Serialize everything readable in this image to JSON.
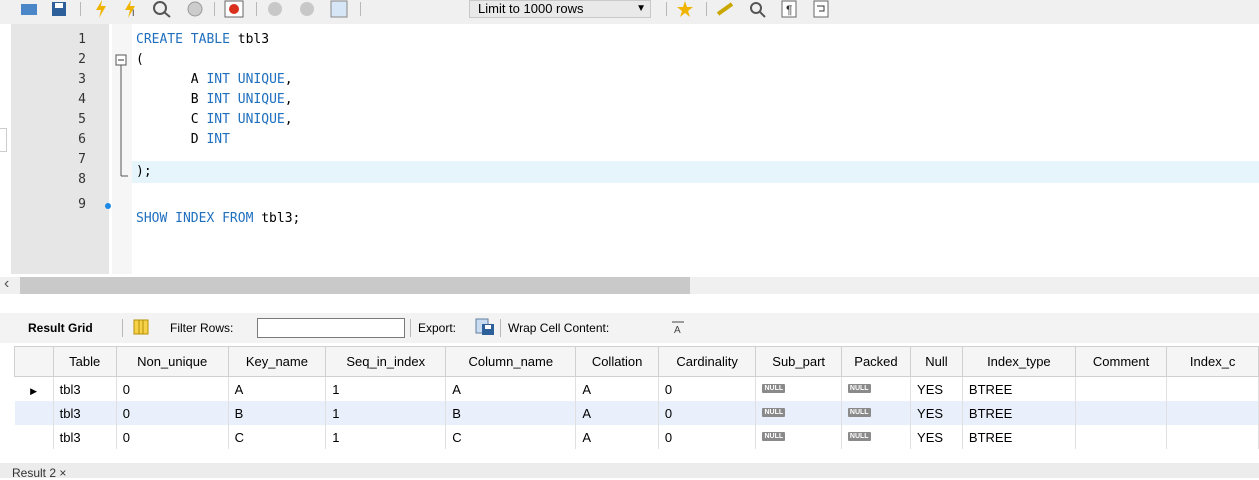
{
  "toolbar": {
    "limit_label": "Limit to 1000 rows"
  },
  "editor": {
    "line_numbers": [
      "1",
      "2",
      "3",
      "4",
      "5",
      "6",
      "7",
      "8",
      "9"
    ],
    "lines": [
      {
        "id": "l1",
        "parts": [
          {
            "t": "CREATE TABLE ",
            "k": true
          },
          {
            "t": "tbl3",
            "k": false
          }
        ]
      },
      {
        "id": "l2",
        "parts": [
          {
            "t": "(",
            "k": false
          }
        ]
      },
      {
        "id": "l3",
        "parts": [
          {
            "t": "       A ",
            "k": false
          },
          {
            "t": "INT UNIQUE",
            "k": true
          },
          {
            "t": ",",
            "k": false
          }
        ]
      },
      {
        "id": "l4",
        "parts": [
          {
            "t": "       B ",
            "k": false
          },
          {
            "t": "INT UNIQUE",
            "k": true
          },
          {
            "t": ",",
            "k": false
          }
        ]
      },
      {
        "id": "l5",
        "parts": [
          {
            "t": "       C ",
            "k": false
          },
          {
            "t": "INT UNIQUE",
            "k": true
          },
          {
            "t": ",",
            "k": false
          }
        ]
      },
      {
        "id": "l6",
        "parts": [
          {
            "t": "       D ",
            "k": false
          },
          {
            "t": "INT",
            "k": true
          }
        ]
      },
      {
        "id": "l7",
        "parts": [
          {
            "t": ");",
            "k": false
          }
        ]
      },
      {
        "id": "l8",
        "parts": []
      },
      {
        "id": "l9",
        "parts": [
          {
            "t": "SHOW INDEX FROM ",
            "k": true
          },
          {
            "t": "tbl3;",
            "k": false
          }
        ]
      }
    ]
  },
  "result_toolbar": {
    "result_grid": "Result Grid",
    "filter_rows": "Filter Rows:",
    "export": "Export:",
    "wrap": "Wrap Cell Content:"
  },
  "grid": {
    "columns": [
      "Table",
      "Non_unique",
      "Key_name",
      "Seq_in_index",
      "Column_name",
      "Collation",
      "Cardinality",
      "Sub_part",
      "Packed",
      "Null",
      "Index_type",
      "Comment",
      "Index_c"
    ],
    "null_label": "NULL",
    "rows": [
      [
        "tbl3",
        "0",
        "A",
        "1",
        "A",
        "A",
        "0",
        "NULL",
        "NULL",
        "YES",
        "BTREE",
        "",
        ""
      ],
      [
        "tbl3",
        "0",
        "B",
        "1",
        "B",
        "A",
        "0",
        "NULL",
        "NULL",
        "YES",
        "BTREE",
        "",
        ""
      ],
      [
        "tbl3",
        "0",
        "C",
        "1",
        "C",
        "A",
        "0",
        "NULL",
        "NULL",
        "YES",
        "BTREE",
        "",
        ""
      ]
    ]
  },
  "tabs": {
    "result2": "Result 2 ×"
  }
}
